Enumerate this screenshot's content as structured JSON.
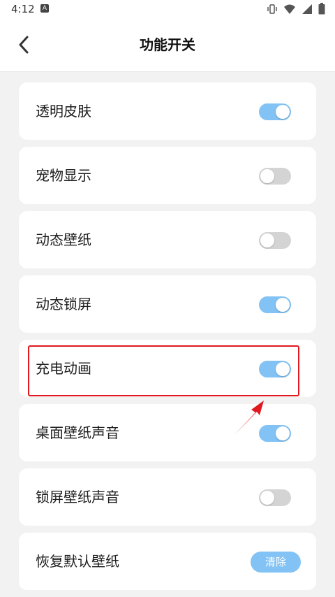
{
  "status_bar": {
    "time": "4:12",
    "notification_icon": "A",
    "icons": [
      "vibrate-icon",
      "wifi-icon",
      "signal-icon",
      "battery-icon"
    ]
  },
  "header": {
    "title": "功能开关",
    "back_icon": "chevron-left-icon"
  },
  "settings": [
    {
      "label": "透明皮肤",
      "control": "toggle",
      "on": true
    },
    {
      "label": "宠物显示",
      "control": "toggle",
      "on": false
    },
    {
      "label": "动态壁纸",
      "control": "toggle",
      "on": false
    },
    {
      "label": "动态锁屏",
      "control": "toggle",
      "on": true
    },
    {
      "label": "充电动画",
      "control": "toggle",
      "on": true,
      "highlighted": true
    },
    {
      "label": "桌面壁纸声音",
      "control": "toggle",
      "on": true
    },
    {
      "label": "锁屏壁纸声音",
      "control": "toggle",
      "on": false
    },
    {
      "label": "恢复默认壁纸",
      "control": "button",
      "button_label": "清除"
    }
  ],
  "colors": {
    "toggle_on": "#82c2f4",
    "toggle_off": "#d4d4d4",
    "highlight": "#e0191f",
    "background": "#f2f2f2"
  }
}
